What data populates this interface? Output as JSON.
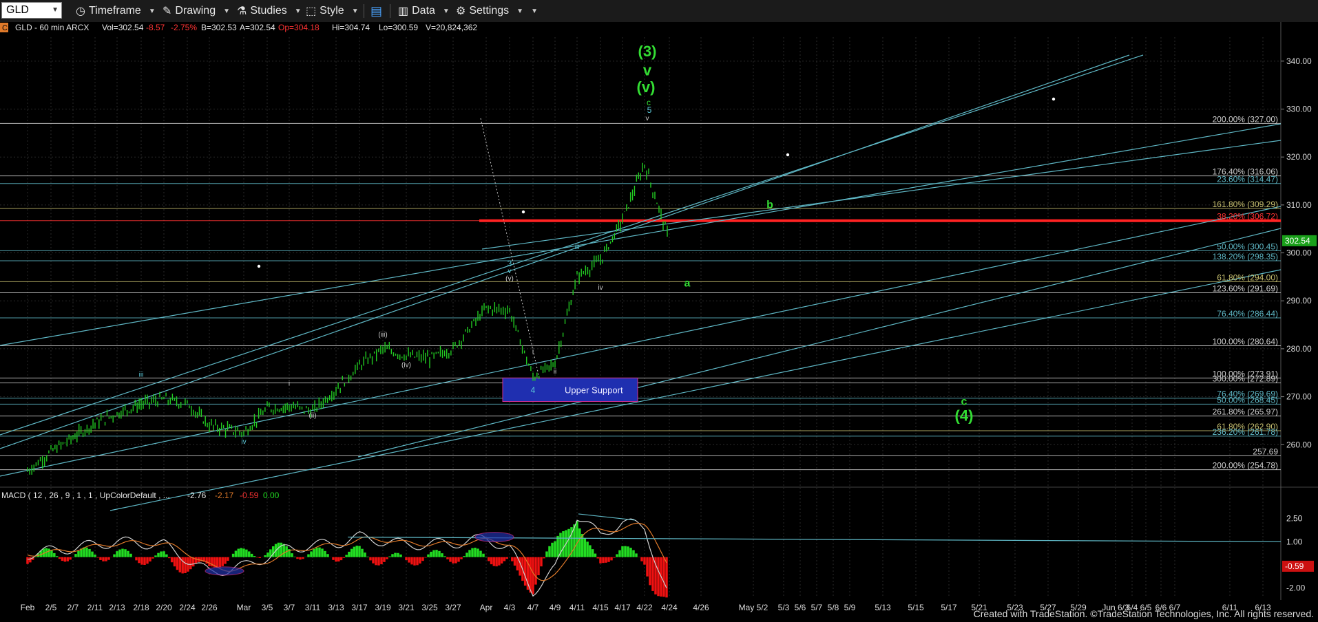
{
  "toolbar": {
    "symbol": "GLD",
    "timeframe_label": "Timeframe",
    "drawing_label": "Drawing",
    "studies_label": "Studies",
    "style_label": "Style",
    "data_label": "Data",
    "settings_label": "Settings",
    "icons": [
      "timeframe-icon",
      "drawing-icon",
      "studies-icon",
      "style-icon",
      "layout-icon",
      "data-icon",
      "gear-icon"
    ]
  },
  "chart_header": {
    "badge": "C",
    "symbol_desc": "GLD - 60 min ARCX",
    "last": "Vol=302.54",
    "change": "-8.57",
    "change_pct": "-2.75%",
    "bid": "B=302.53",
    "ask": "A=302.54",
    "open": "Op=304.18",
    "high": "Hi=304.74",
    "low": "Lo=300.59",
    "volume": "V=20,824,362"
  },
  "macd_header": {
    "label": "MACD ( 12 , 26 , 9 , 1 , 1 , UpColorDefault , ...",
    "v1": "-2.76",
    "v2": "-2.17",
    "v3": "-0.59",
    "v4": "0.00"
  },
  "footer": "Created with TradeStation. ©TradeStation Technologies, Inc. All rights reserved.",
  "colors": {
    "background": "#000000",
    "candle": "#22cc22",
    "trendline": "#5fb8c6",
    "resistance": "#ff2222",
    "wave_green": "#33dd33",
    "wave_cyan": "#5bc8d8",
    "wave_white": "#cccccc",
    "support_box": "#1f2fb0",
    "macd_line": "#d0d0d0",
    "signal_line": "#e07a2a",
    "hist_pos": "#22dd22",
    "hist_neg": "#ee1111"
  },
  "chart_data": {
    "type": "line",
    "title": "GLD - 60 min ARCX",
    "x_tick_labels": [
      "Feb",
      "2/5",
      "2/7",
      "2/11",
      "2/13",
      "2/18",
      "2/20",
      "2/24",
      "2/26",
      "Mar",
      "3/5",
      "3/7",
      "3/11",
      "3/13",
      "3/17",
      "3/19",
      "3/21",
      "3/25",
      "3/27",
      "Apr",
      "4/3",
      "4/7",
      "4/9",
      "4/11",
      "4/15",
      "4/17",
      "4/22",
      "4/24",
      "4/26",
      "May 5/2",
      "5/3",
      "5/6",
      "5/7",
      "5/8",
      "5/9",
      "5/13",
      "5/15",
      "5/17",
      "5/21",
      "5/23",
      "5/27",
      "5/29",
      "Jun 6/3",
      "6/4",
      "6/5",
      "6/6",
      "6/7",
      "6/11",
      "6/13"
    ],
    "y_range": [
      252,
      345
    ],
    "y_ticks": [
      "260.00",
      "270.00",
      "280.00",
      "290.00",
      "300.00",
      "310.00",
      "320.00",
      "330.00",
      "340.00"
    ],
    "current_price": "302.54",
    "price_path": [
      {
        "d": "Feb",
        "v": 254.5
      },
      {
        "d": "2/5",
        "v": 258.5
      },
      {
        "d": "2/7",
        "v": 261.5
      },
      {
        "d": "2/11",
        "v": 264.5
      },
      {
        "d": "2/13",
        "v": 266.5
      },
      {
        "d": "2/18",
        "v": 268.5
      },
      {
        "d": "2/20",
        "v": 269.5
      },
      {
        "d": "2/24",
        "v": 268.5
      },
      {
        "d": "2/26",
        "v": 264.0
      },
      {
        "d": "Mar",
        "v": 262.5
      },
      {
        "d": "3/5",
        "v": 267.5
      },
      {
        "d": "3/7",
        "v": 268.0
      },
      {
        "d": "3/11",
        "v": 267.0
      },
      {
        "d": "3/13",
        "v": 271.5
      },
      {
        "d": "3/17",
        "v": 276.5
      },
      {
        "d": "3/19",
        "v": 280.0
      },
      {
        "d": "3/21",
        "v": 278.5
      },
      {
        "d": "3/25",
        "v": 278.0
      },
      {
        "d": "3/27",
        "v": 280.0
      },
      {
        "d": "Apr",
        "v": 288.5
      },
      {
        "d": "4/3",
        "v": 288.0
      },
      {
        "d": "4/7",
        "v": 274.0
      },
      {
        "d": "4/9",
        "v": 277.0
      },
      {
        "d": "4/11",
        "v": 295.0
      },
      {
        "d": "4/15",
        "v": 298.5
      },
      {
        "d": "4/17",
        "v": 307.0
      },
      {
        "d": "4/22",
        "v": 318.5
      },
      {
        "d": "4/24",
        "v": 302.54
      }
    ],
    "price_labels": [
      {
        "text": "200.00% (327.00)",
        "level": 327.0,
        "color": "#cfcfcf"
      },
      {
        "text": "176.40% (316.06)",
        "level": 316.06,
        "color": "#cfcfcf"
      },
      {
        "text": "23.60% (314.47)",
        "level": 314.47,
        "color": "#5fb8c6"
      },
      {
        "text": "161.80% (309.29)",
        "level": 309.29,
        "color": "#c8c070"
      },
      {
        "text": "38.20% (306.72)",
        "level": 306.72,
        "color": "#ff3333"
      },
      {
        "text": "50.00% (300.45)",
        "level": 300.45,
        "color": "#5fb8c6"
      },
      {
        "text": "138.20% (298.35)",
        "level": 298.35,
        "color": "#5fb8c6"
      },
      {
        "text": "61.80% (294.00)",
        "level": 294.0,
        "color": "#c8c070"
      },
      {
        "text": "123.60% (291.69)",
        "level": 291.69,
        "color": "#cfcfcf"
      },
      {
        "text": "76.40% (286.44)",
        "level": 286.44,
        "color": "#5fb8c6"
      },
      {
        "text": "100.00% (280.64)",
        "level": 280.64,
        "color": "#cfcfcf"
      },
      {
        "text": "100.00% (273.91)",
        "level": 273.91,
        "color": "#cfcfcf"
      },
      {
        "text": "300.00% (272.89)",
        "level": 272.89,
        "color": "#cfcfcf"
      },
      {
        "text": "76.40% (269.69)",
        "level": 269.69,
        "color": "#5fb8c6"
      },
      {
        "text": "50.00% (268.45)",
        "level": 268.45,
        "color": "#5fb8c6"
      },
      {
        "text": "261.80% (265.97)",
        "level": 265.97,
        "color": "#cfcfcf"
      },
      {
        "text": "61.80% (262.90)",
        "level": 262.9,
        "color": "#c8c070"
      },
      {
        "text": "236.20% (261.78)",
        "level": 261.78,
        "color": "#5fb8c6"
      },
      {
        "text": "257.69",
        "level": 257.69,
        "color": "#cfcfcf"
      },
      {
        "text": "200.00% (254.78)",
        "level": 254.78,
        "color": "#cfcfcf"
      }
    ],
    "resistance_level": 306.72,
    "support_zone": {
      "label": "Upper Support",
      "low": 269.0,
      "high": 273.91,
      "from": "4/3",
      "to": "4/22"
    },
    "wave_labels": [
      {
        "text": "(3)",
        "d": "4/22",
        "v": 341.0,
        "color": "green",
        "size": "lg"
      },
      {
        "text": "v",
        "d": "4/22",
        "v": 337.0,
        "color": "green",
        "size": "lg"
      },
      {
        "text": "(v)",
        "d": "4/22",
        "v": 333.5,
        "color": "green",
        "size": "lg"
      },
      {
        "text": "c",
        "d": "4/22",
        "v": 330.8,
        "color": "green",
        "size": "sm"
      },
      {
        "text": "5",
        "d": "4/22",
        "v": 329.2,
        "color": "cyan",
        "size": "sm"
      },
      {
        "text": "v",
        "d": "4/22",
        "v": 327.6,
        "color": "white",
        "size": "xs"
      },
      {
        "text": "b",
        "d": "5/13",
        "v": 309.3,
        "color": "green",
        "size": "md"
      },
      {
        "text": "a",
        "d": "4/26",
        "v": 293.0,
        "color": "green",
        "size": "md"
      },
      {
        "text": "c",
        "d": "5/17",
        "v": 268.3,
        "color": "green",
        "size": "md"
      },
      {
        "text": "(4)",
        "d": "5/17",
        "v": 265.0,
        "color": "green",
        "size": "lg"
      },
      {
        "text": "3",
        "d": "4/3",
        "v": 297.2,
        "color": "cyan",
        "size": "sm"
      },
      {
        "text": "v",
        "d": "4/3",
        "v": 295.8,
        "color": "cyan",
        "size": "xs"
      },
      {
        "text": "(v)",
        "d": "4/3",
        "v": 294.2,
        "color": "white",
        "size": "xs"
      },
      {
        "text": "iii",
        "d": "4/11",
        "v": 300.8,
        "color": "cyan",
        "size": "xs"
      },
      {
        "text": "iv",
        "d": "4/15",
        "v": 292.3,
        "color": "white",
        "size": "xs"
      },
      {
        "text": "i",
        "d": "4/7",
        "v": 279.0,
        "color": "white",
        "size": "xs"
      },
      {
        "text": "ii",
        "d": "4/9",
        "v": 274.8,
        "color": "white",
        "size": "xs"
      },
      {
        "text": "4",
        "d": "4/7",
        "v": 270.8,
        "color": "cyan",
        "size": "sm"
      },
      {
        "text": "(iii)",
        "d": "3/19",
        "v": 282.5,
        "color": "white",
        "size": "xs"
      },
      {
        "text": "(iv)",
        "d": "3/21",
        "v": 276.2,
        "color": "white",
        "size": "xs"
      },
      {
        "text": "i",
        "d": "3/7",
        "v": 272.3,
        "color": "white",
        "size": "xs"
      },
      {
        "text": "(ii)",
        "d": "3/11",
        "v": 265.6,
        "color": "white",
        "size": "xs"
      },
      {
        "text": "iii",
        "d": "2/18",
        "v": 274.2,
        "color": "cyan",
        "size": "xs"
      },
      {
        "text": "iv",
        "d": "Mar",
        "v": 260.2,
        "color": "cyan",
        "size": "xs"
      }
    ],
    "macd": {
      "y_ticks": [
        "2.50",
        "1.00",
        "-2.00"
      ],
      "current": "-0.59",
      "y_range": [
        -2.6,
        3.2
      ],
      "path": [
        {
          "d": "Feb",
          "v": 0.2
        },
        {
          "d": "2/7",
          "v": 0.6
        },
        {
          "d": "2/13",
          "v": 1.0
        },
        {
          "d": "2/20",
          "v": 0.8
        },
        {
          "d": "2/26",
          "v": -1.0
        },
        {
          "d": "Mar",
          "v": -0.6
        },
        {
          "d": "3/7",
          "v": 0.6
        },
        {
          "d": "3/13",
          "v": 0.9
        },
        {
          "d": "3/17",
          "v": 1.3
        },
        {
          "d": "3/21",
          "v": 0.8
        },
        {
          "d": "3/27",
          "v": 0.9
        },
        {
          "d": "Apr",
          "v": 1.2
        },
        {
          "d": "4/3",
          "v": 0.6
        },
        {
          "d": "4/7",
          "v": -2.2
        },
        {
          "d": "4/9",
          "v": -0.8
        },
        {
          "d": "4/11",
          "v": 2.7
        },
        {
          "d": "4/15",
          "v": 1.4
        },
        {
          "d": "4/17",
          "v": 2.3
        },
        {
          "d": "4/22",
          "v": 1.9
        },
        {
          "d": "4/24",
          "v": -2.76
        }
      ]
    },
    "grid": true
  }
}
